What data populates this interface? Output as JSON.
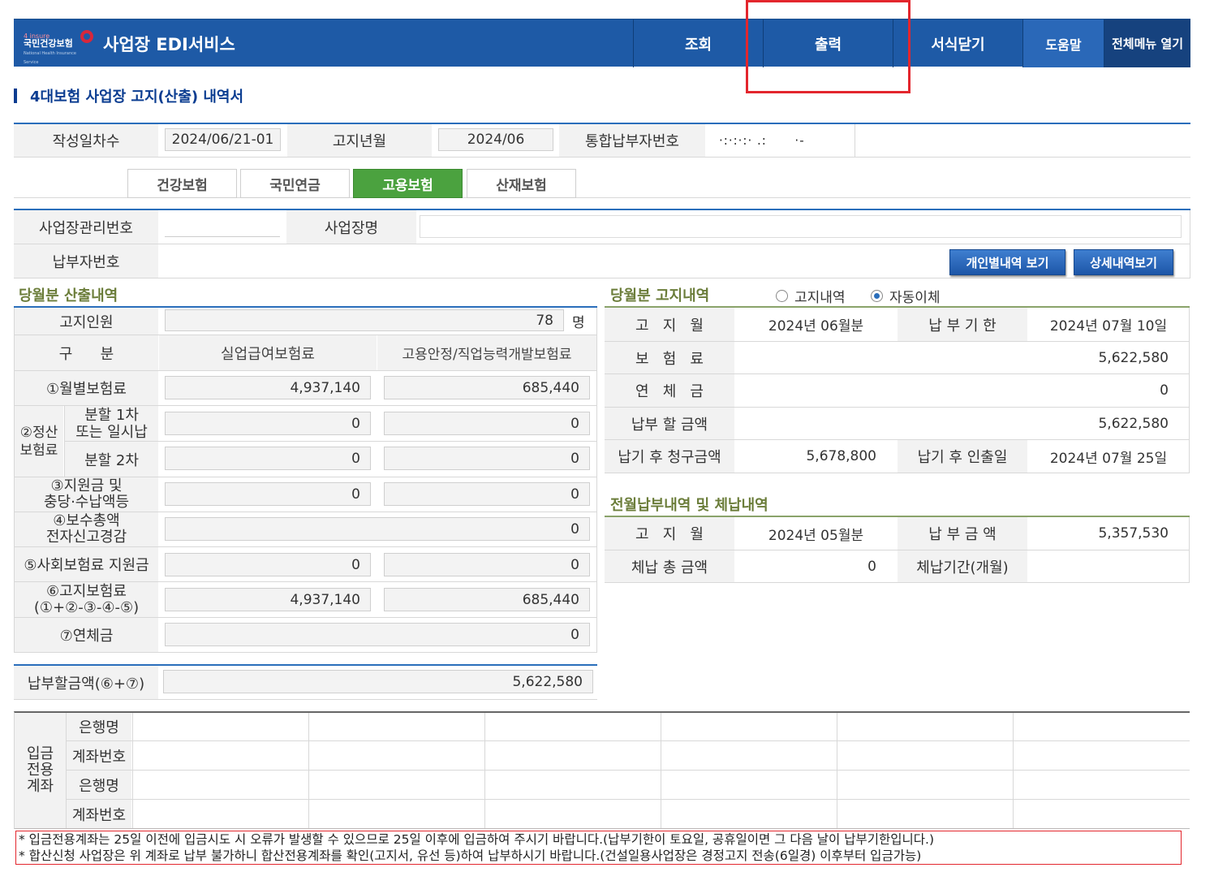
{
  "header": {
    "logo_small": "4 insure",
    "logo_org": "국민건강보험",
    "logo_eng": "National Health Insurance Service",
    "title": "사업장 EDI서비스",
    "nav": {
      "search": "조회",
      "print": "출력",
      "close": "서식닫기",
      "help": "도움말",
      "all_menu": "전체메뉴 열기"
    }
  },
  "page_title": "4대보험 사업장 고지(산출) 내역서",
  "info": {
    "write_label": "작성일차수",
    "write_value": "2024/06/21-01",
    "month_label": "고지년월",
    "month_value": "2024/06",
    "payer_label": "통합납부자번호",
    "payer_value": "·:·:·:· .:      ·-"
  },
  "tabs": [
    "건강보험",
    "국민연금",
    "고용보험",
    "산재보험"
  ],
  "business": {
    "mgmt_label": "사업장관리번호",
    "name_label": "사업장명",
    "payer_label": "납부자번호",
    "btn_personal": "개인별내역 보기",
    "btn_detail": "상세내역보기"
  },
  "calc": {
    "section": "당월분 산출내역",
    "people_label": "고지인원",
    "people_value": "78",
    "people_unit": "명",
    "col_div": "구      분",
    "col_unemp": "실업급여보험료",
    "col_emp": "고용안정/직업능력개발보험료",
    "r1_label": "①월별보험료",
    "r1_a": "4,937,140",
    "r1_b": "685,440",
    "r2_group": "②정산\n보험료",
    "r2a_label": "분할 1차\n또는 일시납",
    "r2a_a": "0",
    "r2a_b": "0",
    "r2b_label": "분할 2차",
    "r2b_a": "0",
    "r2b_b": "0",
    "r3_label": "③지원금 및\n충당·수납액등",
    "r3_a": "0",
    "r3_b": "0",
    "r4_label": "④보수총액\n전자신고경감",
    "r4_v": "0",
    "r5_label": "⑤사회보험료 지원금",
    "r5_a": "0",
    "r5_b": "0",
    "r6_label": "⑥고지보험료\n(①+②-③-④-⑤)",
    "r6_a": "4,937,140",
    "r6_b": "685,440",
    "r7_label": "⑦연체금",
    "r7_v": "0",
    "total_label": "납부할금액(⑥+⑦)",
    "total_value": "5,622,580"
  },
  "notice_box": {
    "section": "당월분 고지내역",
    "radio1": "고지내역",
    "radio2": "자동이체",
    "month_label": "고   지   월",
    "month_value": "2024년 06월분",
    "due_label": "납 부 기 한",
    "due_value": "2024년 07월 10일",
    "premium_label": "보   험   료",
    "premium_value": "5,622,580",
    "late_label": "연   체   금",
    "late_value": "0",
    "pay_label": "납부 할 금액",
    "pay_value": "5,622,580",
    "after_label": "납기 후 청구금액",
    "after_value": "5,678,800",
    "after_date_label": "납기 후 인출일",
    "after_date_value": "2024년 07월 25일"
  },
  "prev": {
    "section": "전월납부내역 및 체납내역",
    "month_label": "고   지   월",
    "month_value": "2024년 05월분",
    "paid_label": "납 부 금 액",
    "paid_value": "5,357,530",
    "arrears_label": "체납 총 금액",
    "arrears_value": "0",
    "period_label": "체납기간(개월)",
    "period_value": ""
  },
  "deposit": {
    "group": "입금\n전용\n계좌",
    "bank_label": "은행명",
    "account_label": "계좌번호"
  },
  "notices": [
    "* 입금전용계좌는 25일 이전에 입금시도 시 오류가 발생할 수 있으므로 25일 이후에 입금하여 주시기 바랍니다.(납부기한이 토요일, 공휴일이면 그 다음 날이 납부기한입니다.)",
    "* 합산신청 사업장은 위 계좌로 납부 불가하니 합산전용계좌를 확인(고지서, 유선 등)하여 납부하시기 바랍니다.(건설일용사업장은 경정고지 전송(6일경) 이후부터 입금가능)"
  ],
  "colors": {
    "header": "#1e5aa6",
    "accent_green": "#4ba23f",
    "section_green": "#6b7d3a",
    "highlight": "#e3262d"
  }
}
